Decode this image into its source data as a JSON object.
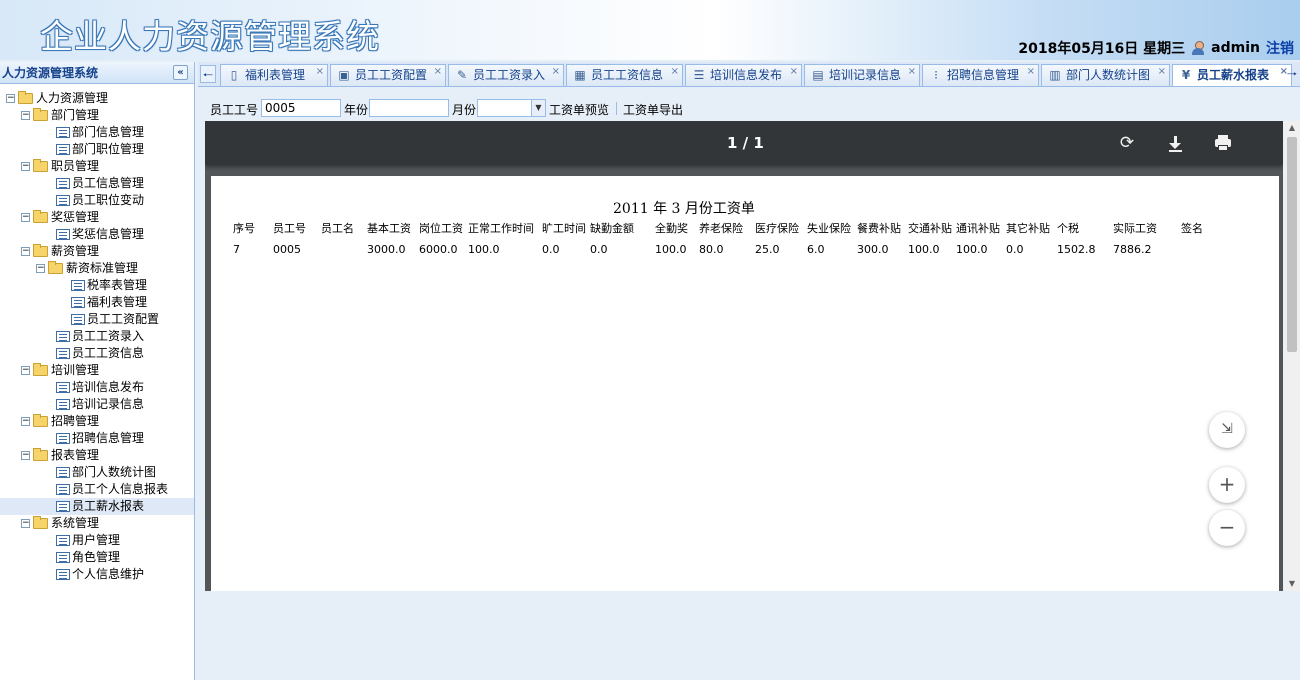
{
  "header": {
    "title": "企业人力资源管理系统",
    "datetime": "2018年05月16日 星期三",
    "user": "admin",
    "logout": "注销"
  },
  "sidebar": {
    "title": "人力资源管理系统",
    "collapse_glyph": "«",
    "tree": [
      {
        "label": "人力资源管理",
        "level": 0,
        "type": "folder",
        "toggle": "⊟"
      },
      {
        "label": "部门管理",
        "level": 1,
        "type": "folder",
        "toggle": "⊟"
      },
      {
        "label": "部门信息管理",
        "level": 2,
        "type": "leaf"
      },
      {
        "label": "部门职位管理",
        "level": 2,
        "type": "leaf"
      },
      {
        "label": "职员管理",
        "level": 1,
        "type": "folder",
        "toggle": "⊟"
      },
      {
        "label": "员工信息管理",
        "level": 2,
        "type": "leaf"
      },
      {
        "label": "员工职位变动",
        "level": 2,
        "type": "leaf"
      },
      {
        "label": "奖惩管理",
        "level": 1,
        "type": "folder",
        "toggle": "⊟"
      },
      {
        "label": "奖惩信息管理",
        "level": 2,
        "type": "leaf"
      },
      {
        "label": "薪资管理",
        "level": 1,
        "type": "folder",
        "toggle": "⊟"
      },
      {
        "label": "薪资标准管理",
        "level": 2,
        "type": "folder",
        "toggle": "⊟"
      },
      {
        "label": "税率表管理",
        "level": 3,
        "type": "leaf"
      },
      {
        "label": "福利表管理",
        "level": 3,
        "type": "leaf"
      },
      {
        "label": "员工工资配置",
        "level": 3,
        "type": "leaf"
      },
      {
        "label": "员工工资录入",
        "level": 2,
        "type": "leaf"
      },
      {
        "label": "员工工资信息",
        "level": 2,
        "type": "leaf"
      },
      {
        "label": "培训管理",
        "level": 1,
        "type": "folder",
        "toggle": "⊟"
      },
      {
        "label": "培训信息发布",
        "level": 2,
        "type": "leaf"
      },
      {
        "label": "培训记录信息",
        "level": 2,
        "type": "leaf"
      },
      {
        "label": "招聘管理",
        "level": 1,
        "type": "folder",
        "toggle": "⊟"
      },
      {
        "label": "招聘信息管理",
        "level": 2,
        "type": "leaf"
      },
      {
        "label": "报表管理",
        "level": 1,
        "type": "folder",
        "toggle": "⊟"
      },
      {
        "label": "部门人数统计图",
        "level": 2,
        "type": "leaf"
      },
      {
        "label": "员工个人信息报表",
        "level": 2,
        "type": "leaf"
      },
      {
        "label": "员工薪水报表",
        "level": 2,
        "type": "leaf",
        "selected": true
      },
      {
        "label": "系统管理",
        "level": 1,
        "type": "folder",
        "toggle": "⊟"
      },
      {
        "label": "用户管理",
        "level": 2,
        "type": "leaf"
      },
      {
        "label": "角色管理",
        "level": 2,
        "type": "leaf"
      },
      {
        "label": "个人信息维护",
        "level": 2,
        "type": "leaf"
      }
    ]
  },
  "tabs": [
    {
      "label": "福利表管理",
      "icon": "document-icon",
      "glyph": "▯"
    },
    {
      "label": "员工工资配置",
      "icon": "money-card-icon",
      "glyph": "▣"
    },
    {
      "label": "员工工资录入",
      "icon": "edit-icon",
      "glyph": "✎"
    },
    {
      "label": "员工工资信息",
      "icon": "table-icon",
      "glyph": "▦"
    },
    {
      "label": "培训信息发布",
      "icon": "list-icon",
      "glyph": "☰"
    },
    {
      "label": "培训记录信息",
      "icon": "grid-icon",
      "glyph": "▤"
    },
    {
      "label": "招聘信息管理",
      "icon": "bullet-list-icon",
      "glyph": "⁝"
    },
    {
      "label": "部门人数统计图",
      "icon": "bar-chart-icon",
      "glyph": "▥"
    },
    {
      "label": "员工薪水报表",
      "icon": "yen-icon",
      "glyph": "¥",
      "active": true
    }
  ],
  "tab_close_glyph": "×",
  "toolbar": {
    "emp_no_label": "员工工号",
    "emp_no_value": "0005",
    "year_label": "年份",
    "year_value": "",
    "month_label": "月份",
    "month_value": "",
    "preview_label": "工资单预览",
    "export_label": "工资单导出"
  },
  "viewer": {
    "page_counter": "1 / 1",
    "rotate_glyph": "⟳",
    "fit_glyph": "⤓",
    "zoom_in_glyph": "+",
    "zoom_out_glyph": "−"
  },
  "payslip": {
    "title": "2011  年   3  月份工资单",
    "columns": [
      "序号",
      "员工号",
      "员工名",
      "基本工资",
      "岗位工资",
      "正常工作时间",
      "旷工时间",
      "缺勤金额",
      "全勤奖",
      "养老保险",
      "医疗保险",
      "失业保险",
      "餐费补贴",
      "交通补贴",
      "通讯补贴",
      "其它补贴",
      "个税",
      "实际工资",
      "签名"
    ],
    "row": [
      "7",
      "0005",
      "",
      "3000.0",
      "6000.0",
      "100.0",
      "0.0",
      "0.0",
      "100.0",
      "80.0",
      "25.0",
      "6.0",
      "300.0",
      "100.0",
      "100.0",
      "0.0",
      "1502.8",
      "7886.2",
      ""
    ]
  }
}
